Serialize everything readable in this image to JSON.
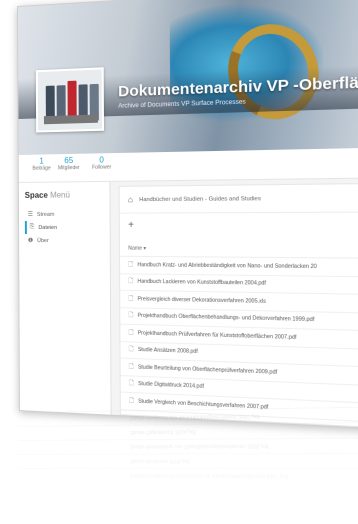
{
  "header": {
    "title": "Dokumentenarchiv VP -Oberfläche",
    "subtitle": "Archive of Documents VP Surface Processes"
  },
  "stats": [
    {
      "value": "1",
      "label": "Beiträge"
    },
    {
      "value": "65",
      "label": "Mitglieder"
    },
    {
      "value": "0",
      "label": "Follower"
    }
  ],
  "sidebar": {
    "title_bold": "Space",
    "title_light": "Menü",
    "items": [
      {
        "icon": "stream-icon",
        "label": "Stream",
        "active": false
      },
      {
        "icon": "files-icon",
        "label": "Dateien",
        "active": true
      },
      {
        "icon": "info-icon",
        "label": "Über",
        "active": false
      }
    ]
  },
  "breadcrumb": {
    "path": "Handbücher und Studien - Guides and Studies"
  },
  "table": {
    "column_name": "Name ▾",
    "files": [
      "Handbuch Kratz- und Abriebbeständigkeit von Nano- und Sonderlacken 20",
      "Handbuch Lackieren von Kunststoffbauteilen 2004.pdf",
      "Preisvergleich diverser Dekorationsverfahren 2005.xls",
      "Projekthandbuch Oberflächenbehandlungs- und Dekorverfahren 1999.pdf",
      "Projekthandbuch Prüfverfahren für Kunststoffoberflächen 2007.pdf",
      "Studie Ansätzen 2008.pdf",
      "Studie Beurteilung von Oberflächenprüfverfahren 2009.pdf",
      "Studie Digitaldruck 2014.pdf",
      "Studie Vergleich von Beschichtungsverfahren 2007.pdf"
    ]
  },
  "reflection": [
    "Studie Vergleich von Beschichtungsverfahren 2007.pdf",
    "Studie Digitaldruck 2014.pdf",
    "Studie Beurteilung von Oberflächenprüfverfahren 2009.pdf",
    "Studie Ansätzen 2008.pdf",
    "Projekthandbuch Prüfverfahren für Kunststoffoberflächen 2007.pdf"
  ]
}
